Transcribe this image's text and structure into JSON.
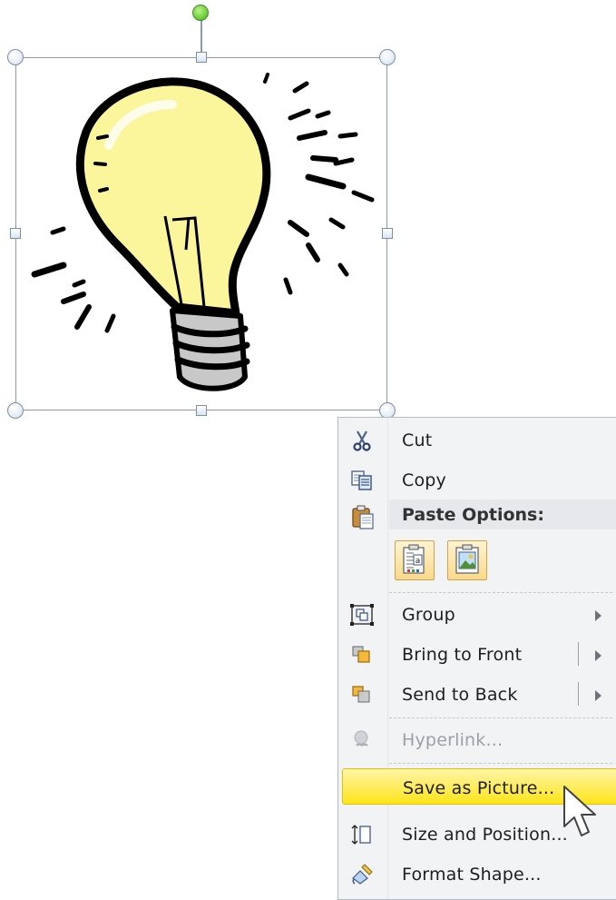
{
  "clip_art": {
    "subject": "lightbulb-clipart",
    "colors": {
      "bulb_fill": "#fbf59b",
      "outline": "#000000",
      "base": "#c8c8c8"
    }
  },
  "selection": {
    "frame_color": "#8a9ab5",
    "rotation_handle_color": "#6fcf3a"
  },
  "context_menu": {
    "items": [
      {
        "id": "cut",
        "label": "Cut",
        "icon": "scissors-icon"
      },
      {
        "id": "copy",
        "label": "Copy",
        "icon": "copy-icon"
      }
    ],
    "paste_options": {
      "header": "Paste Options:",
      "buttons": [
        {
          "name": "paste-use-destination-theme",
          "icon": "paste-text-icon"
        },
        {
          "name": "paste-picture",
          "icon": "paste-picture-icon"
        }
      ]
    },
    "group": {
      "label": "Group",
      "icon": "group-icon"
    },
    "bring_to_front": {
      "label": "Bring to Front",
      "icon": "bring-to-front-icon"
    },
    "send_to_back": {
      "label": "Send to Back",
      "icon": "send-to-back-icon"
    },
    "hyperlink": {
      "label": "Hyperlink...",
      "icon": "hyperlink-icon",
      "enabled": false
    },
    "save_as_picture": {
      "label": "Save as Picture...",
      "highlighted": true,
      "highlight_color": "#ffe41a"
    },
    "size_and_position": {
      "label": "Size and Position...",
      "icon": "size-position-icon"
    },
    "format_shape": {
      "label": "Format Shape...",
      "icon": "format-shape-icon"
    }
  }
}
